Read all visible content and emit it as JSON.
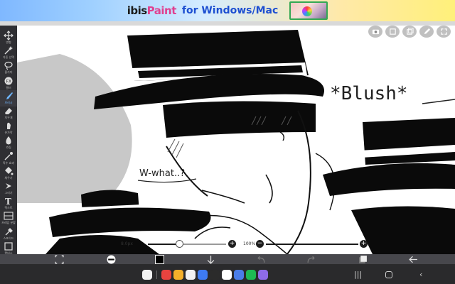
{
  "banner": {
    "logo_prefix": "ibis",
    "logo_paint": "Paint",
    "tagline": "for Windows/Mac"
  },
  "toolbar": {
    "tools": [
      {
        "label": "변형",
        "icon": "move-icon"
      },
      {
        "label": "자동 선택",
        "icon": "magic-wand-icon"
      },
      {
        "label": "올가미",
        "icon": "lasso-icon"
      },
      {
        "label": "필터",
        "icon": "filter-icon"
      },
      {
        "label": "브러시",
        "icon": "brush-icon",
        "active": true
      },
      {
        "label": "지우개",
        "icon": "eraser-icon"
      },
      {
        "label": "손가락",
        "icon": "smudge-icon"
      },
      {
        "label": "흐림",
        "icon": "blur-icon"
      },
      {
        "label": "특수 효과",
        "icon": "special-effects-icon"
      },
      {
        "label": "채우기",
        "icon": "bucket-icon"
      },
      {
        "label": "그리기",
        "icon": "pen-icon"
      },
      {
        "label": "텍스트",
        "icon": "text-icon"
      },
      {
        "label": "프레임 분할",
        "icon": "frame-divider-icon"
      },
      {
        "label": "스포이드",
        "icon": "eyedropper-icon"
      },
      {
        "label": "캔버스",
        "icon": "canvas-icon"
      }
    ]
  },
  "canvas_icons": [
    "camera-icon",
    "layers-icon",
    "copy-icon",
    "edit-icon",
    "fullscreen-icon"
  ],
  "artwork": {
    "text_blush": "*Blush*",
    "text_what": "W-what..?"
  },
  "sliders": {
    "brush_size": "8.0px",
    "brush_size_fraction": 0.4,
    "opacity": "100%",
    "opacity_fraction": 1.0
  },
  "bottombar": {
    "icons": [
      "transform-icon",
      "brush-preview-icon",
      "color-icon",
      "download-icon",
      "undo-icon",
      "redo-icon",
      "layer-icon",
      "back-icon"
    ]
  },
  "dock": {
    "apps": [
      {
        "name": "apps-grid-icon",
        "color": "#f2f2f2"
      },
      {
        "name": "redcard-app-icon",
        "color": "#e8433f"
      },
      {
        "name": "files-app-icon",
        "color": "#f5b02a"
      },
      {
        "name": "notes-app-icon",
        "color": "#f2f2f2"
      },
      {
        "name": "gallery-app-icon",
        "color": "#3e7bf3"
      },
      {
        "name": "camera-app-icon",
        "color": "#2b2b2b"
      },
      {
        "name": "ibis-app-icon",
        "color": "#ffffff"
      },
      {
        "name": "pen-app-icon",
        "color": "#4a7de8"
      },
      {
        "name": "spotify-app-icon",
        "color": "#1db954"
      },
      {
        "name": "chat-app-icon",
        "color": "#8e6be8"
      }
    ]
  }
}
